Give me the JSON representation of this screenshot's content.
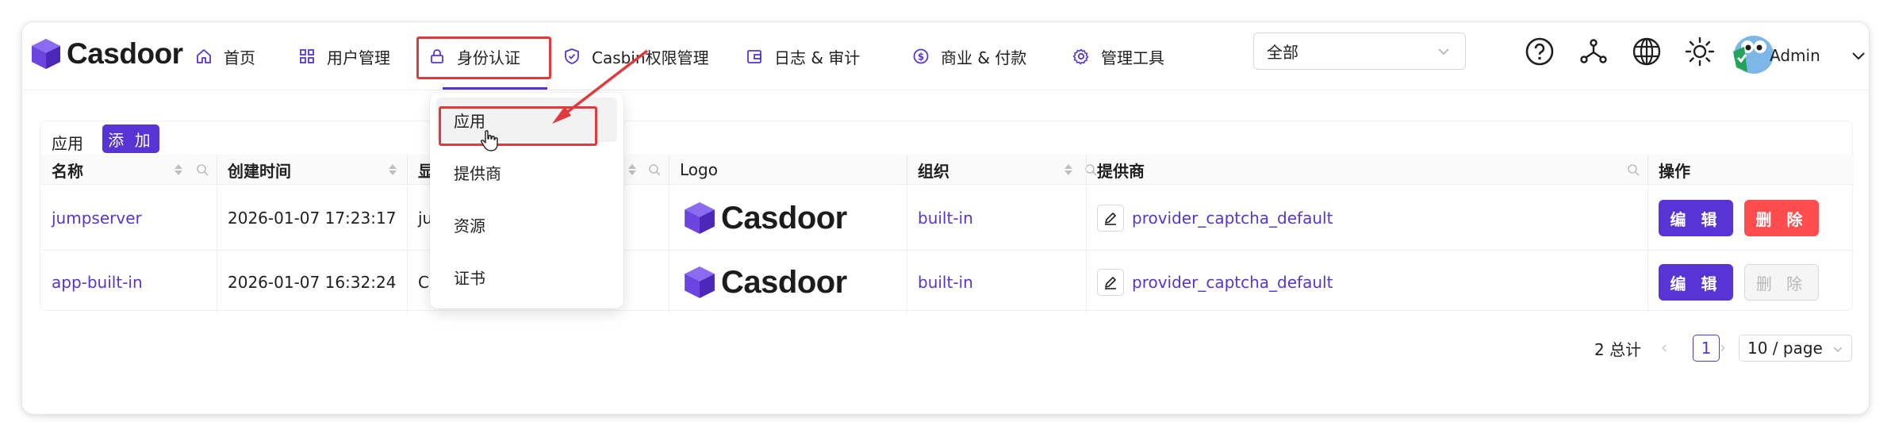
{
  "app": {
    "logo_text": "Casdoor",
    "user_name": "Admin"
  },
  "nav": {
    "items": [
      {
        "label": "首页",
        "icon": "home-icon"
      },
      {
        "label": "用户管理",
        "icon": "grid-icon"
      },
      {
        "label": "身份认证",
        "icon": "lock-icon",
        "active": true
      },
      {
        "label": "Casbin权限管理",
        "icon": "shield-check-icon"
      },
      {
        "label": "日志 & 审计",
        "icon": "wallet-icon"
      },
      {
        "label": "商业 & 付款",
        "icon": "dollar-icon"
      },
      {
        "label": "管理工具",
        "icon": "gear-icon"
      }
    ],
    "dropdown": [
      {
        "label": "应用"
      },
      {
        "label": "提供商"
      },
      {
        "label": "资源"
      },
      {
        "label": "证书"
      }
    ]
  },
  "header_tools": {
    "org_select_value": "全部",
    "icons": [
      "help-icon",
      "network-icon",
      "globe-icon",
      "theme-sun-icon",
      "avatar"
    ]
  },
  "table": {
    "title": "应用",
    "add_label": "添 加",
    "columns": [
      "名称",
      "创建时间",
      "显",
      "Logo",
      "组织",
      "提供商",
      "操作"
    ],
    "rows": [
      {
        "name": "jumpserver",
        "created": "2026-01-07 17:23:17",
        "display": "ju",
        "logo_text": "Casdoor",
        "org": "built-in",
        "provider": "provider_captcha_default",
        "edit_label": "编 辑",
        "delete_label": "删 除",
        "delete_disabled": false
      },
      {
        "name": "app-built-in",
        "created": "2026-01-07 16:32:24",
        "display": "C",
        "logo_text": "Casdoor",
        "org": "built-in",
        "provider": "provider_captcha_default",
        "edit_label": "编 辑",
        "delete_label": "删 除",
        "delete_disabled": true
      }
    ]
  },
  "pagination": {
    "total": "2 总计",
    "current_page": "1",
    "page_size": "10 / page"
  },
  "colors": {
    "accent": "#5734d3",
    "danger": "#ff4d4f",
    "annotation": "#e0393e"
  }
}
